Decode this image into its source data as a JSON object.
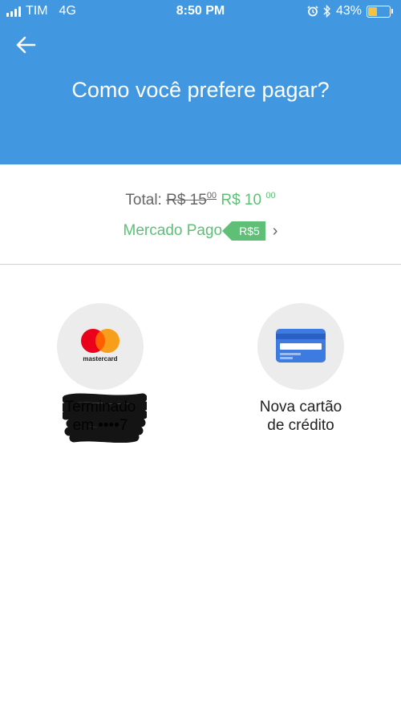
{
  "status_bar": {
    "carrier": "TIM",
    "network": "4G",
    "time": "8:50 PM",
    "battery": "43%",
    "battery_level": 0.43,
    "icons": [
      "signal-icon",
      "alarm-icon",
      "bluetooth-icon",
      "battery-icon"
    ]
  },
  "header": {
    "title": "Como você prefere pagar?",
    "back_icon": "arrow-left-icon",
    "background_color": "#4197E0"
  },
  "summary": {
    "total_label": "Total:",
    "old_price_main": "R$ 15",
    "old_price_cents": "00",
    "new_price_main": "R$ 10",
    "new_price_cents": "00",
    "discount_provider": "Mercado Pago",
    "discount_value": "R$5",
    "accent_color": "#5FBF77"
  },
  "payment_options": [
    {
      "icon": "mastercard-logo",
      "brand_text": "mastercard",
      "label_line1": "Terminado",
      "label_line2": "em ••••7"
    },
    {
      "icon": "credit-card-icon",
      "label_line1": "Nova cartão",
      "label_line2": "de crédito"
    }
  ]
}
